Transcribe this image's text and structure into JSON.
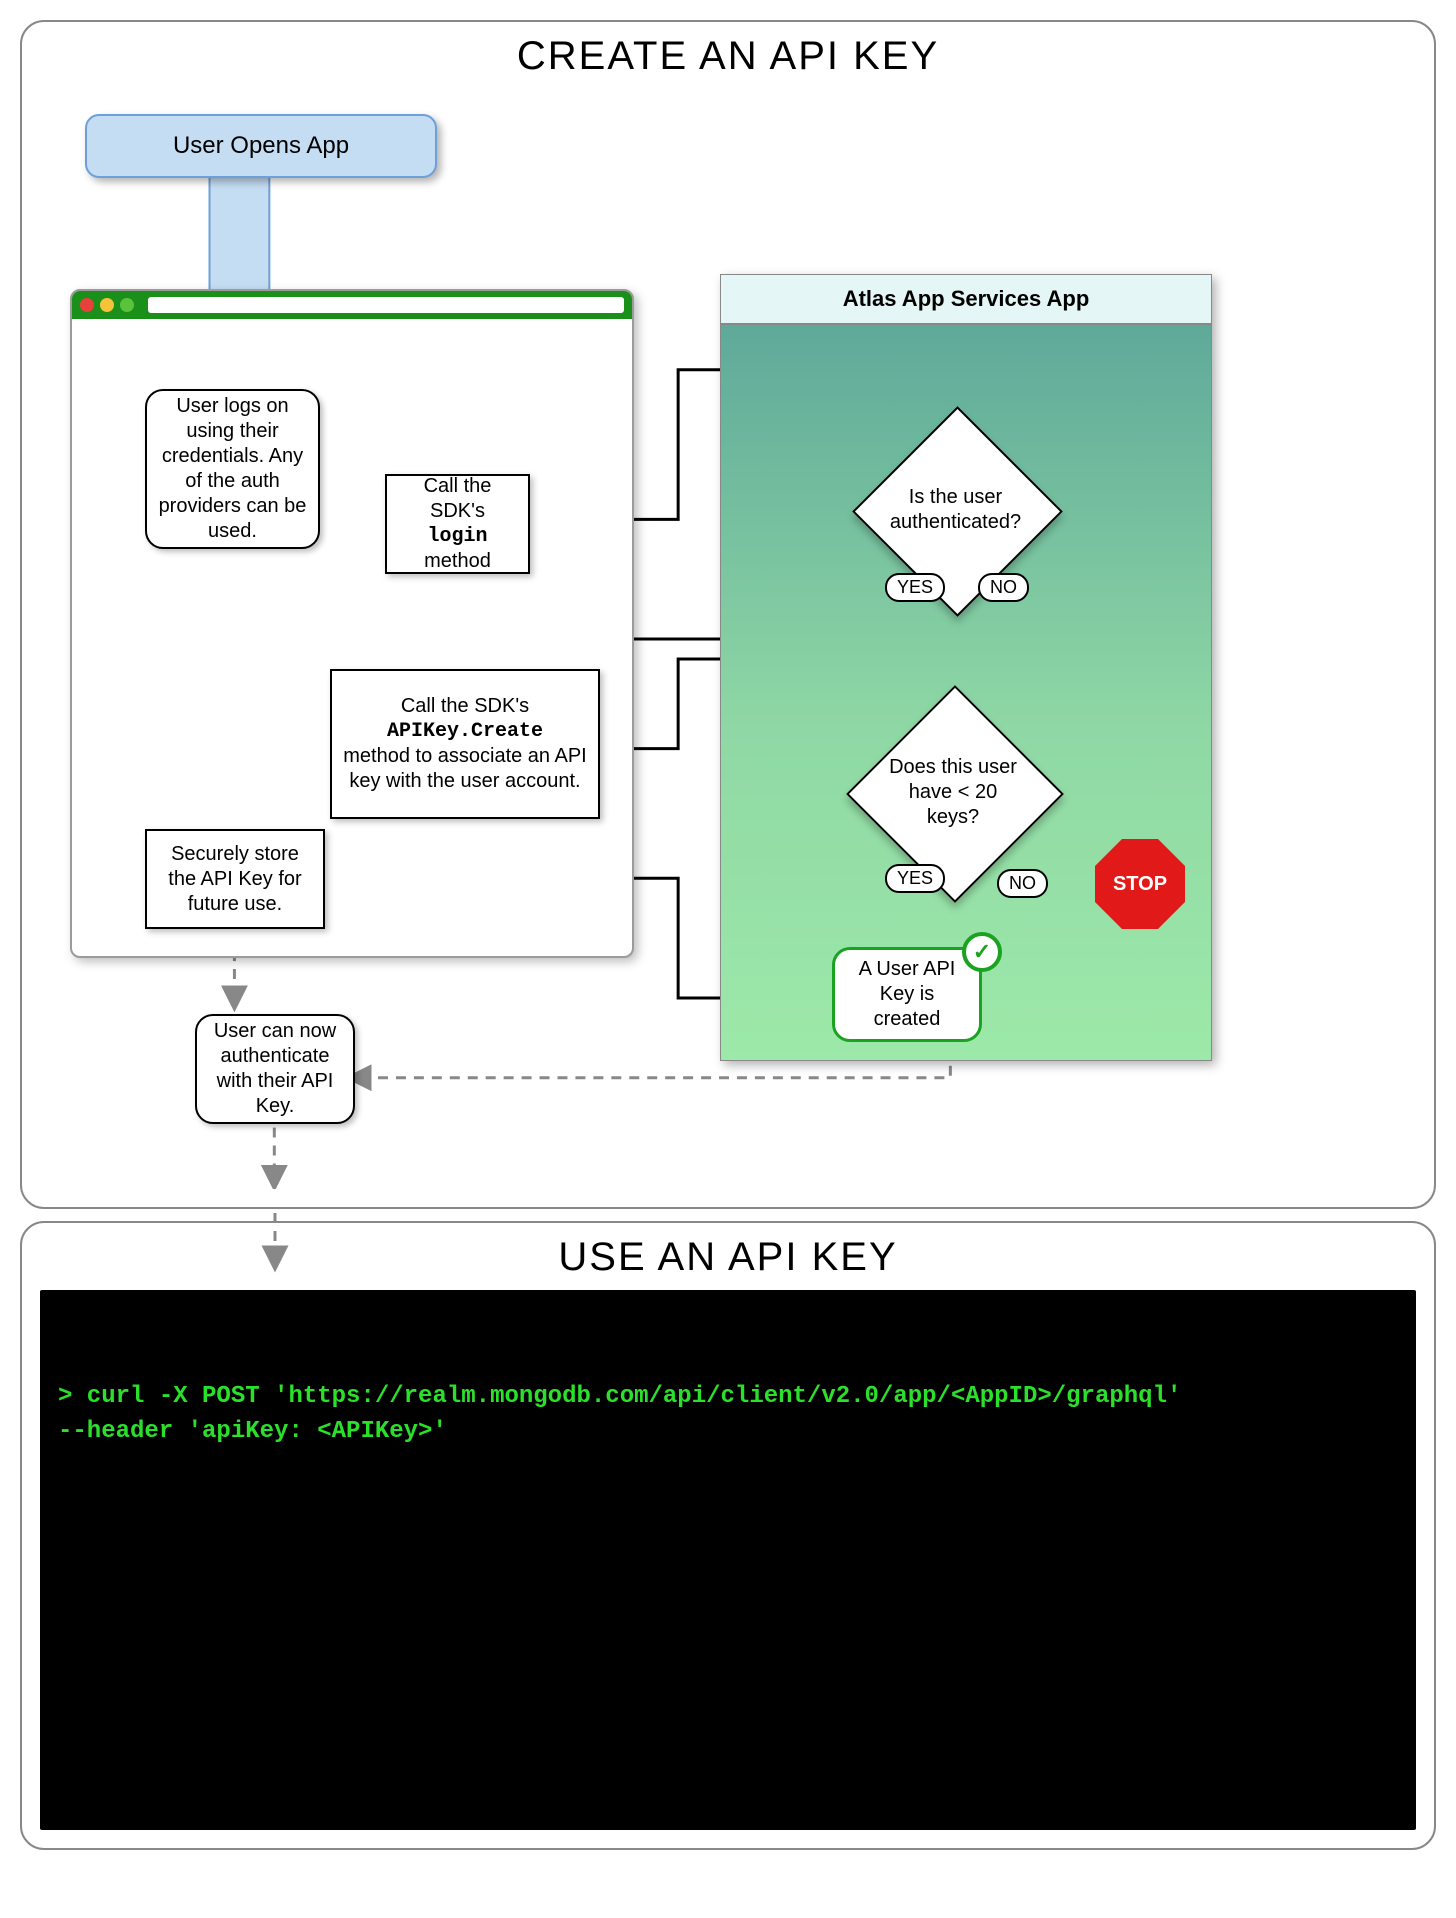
{
  "create": {
    "title": "CREATE AN API KEY",
    "start": "User Opens App",
    "login_box": "User logs on using their credentials. Any of the auth providers can be used.",
    "call_login_pre": "Call the SDK's",
    "call_login_code": "login",
    "call_login_post": "method",
    "call_create_pre": "Call the SDK's",
    "call_create_code": "APIKey.Create",
    "call_create_post": "method to associate an API key with the user account.",
    "store_box": "Securely store the API Key for future use.",
    "auth_box": "User can now authenticate with their API Key.",
    "atlas_title": "Atlas App Services App",
    "diamond_auth": "Is the user authenticated?",
    "diamond_keys": "Does this user have < 20 keys?",
    "yes": "YES",
    "no": "NO",
    "stop": "STOP",
    "keycreated": "A User API Key is created"
  },
  "use": {
    "title": "USE AN API KEY",
    "terminal_text": "> curl -X POST 'https://realm.mongodb.com/api/client/v2.0/app/<AppID>/graphql'\n--header 'apiKey: <APIKey>'"
  }
}
